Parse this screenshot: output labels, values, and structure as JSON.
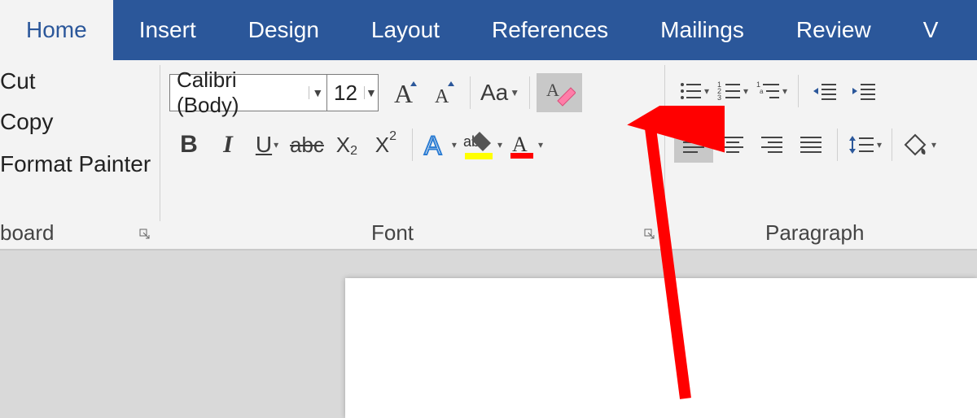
{
  "tabs": {
    "items": [
      "Home",
      "Insert",
      "Design",
      "Layout",
      "References",
      "Mailings",
      "Review",
      "V"
    ],
    "active_index": 0
  },
  "clipboard": {
    "cut": "Cut",
    "copy": "Copy",
    "format_painter": "Format Painter",
    "group_label": "board"
  },
  "font": {
    "name": "Calibri (Body)",
    "size": "12",
    "group_label": "Font",
    "change_case_label": "Aa"
  },
  "paragraph": {
    "group_label": "Paragraph"
  },
  "annotation": {
    "type": "arrow",
    "target": "clear-formatting-button",
    "color": "#ff0000"
  }
}
